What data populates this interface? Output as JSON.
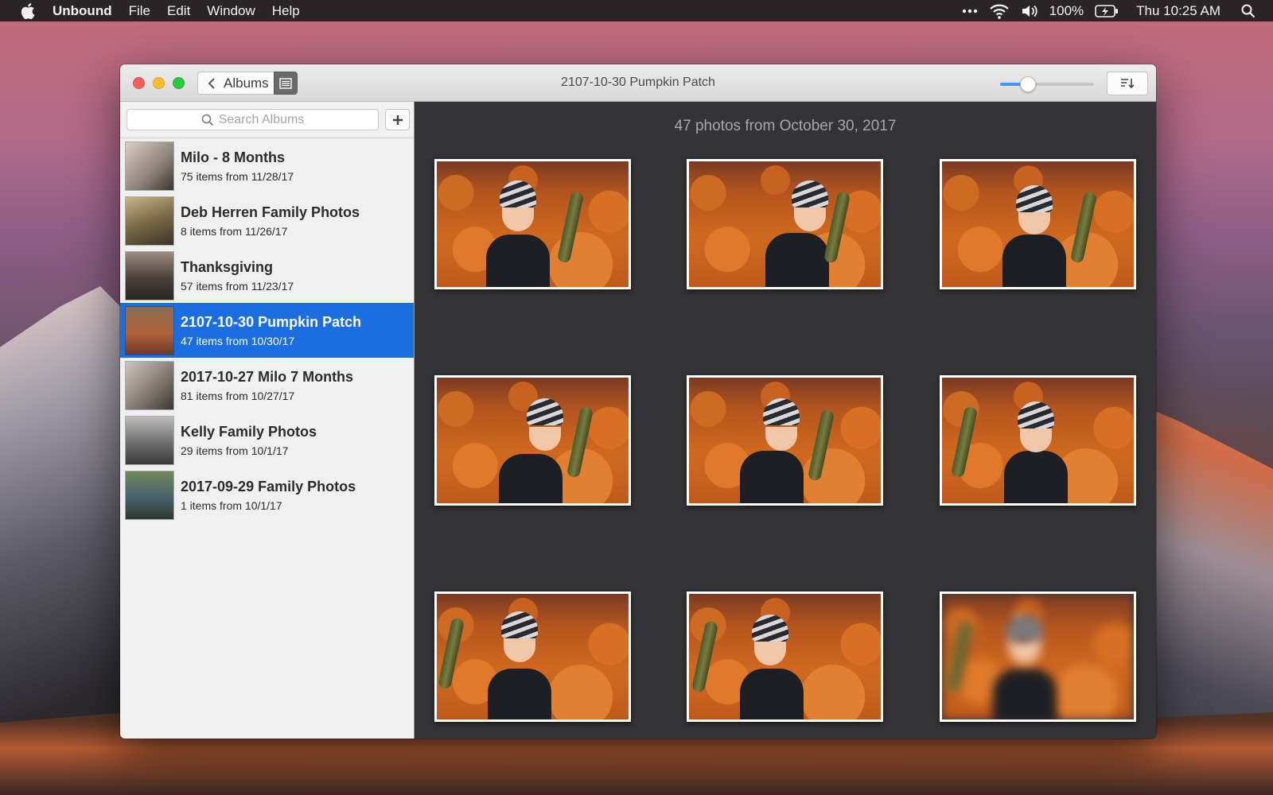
{
  "menubar": {
    "app_name": "Unbound",
    "items": [
      "File",
      "Edit",
      "Window",
      "Help"
    ],
    "battery": "100%",
    "clock": "Thu 10:25 AM"
  },
  "window": {
    "title": "2107-10-30 Pumpkin Patch",
    "back_label": "Albums",
    "zoom_level": 0.3
  },
  "sidebar": {
    "search_placeholder": "Search Albums",
    "albums": [
      {
        "name": "Milo - 8 Months",
        "meta": "75 items from 11/28/17"
      },
      {
        "name": "Deb Herren Family Photos",
        "meta": "8 items from 11/26/17"
      },
      {
        "name": "Thanksgiving",
        "meta": "57 items from 11/23/17"
      },
      {
        "name": "2107-10-30 Pumpkin Patch",
        "meta": "47 items from 10/30/17"
      },
      {
        "name": "2017-10-27 Milo 7 Months",
        "meta": "81 items from 10/27/17"
      },
      {
        "name": "Kelly Family Photos",
        "meta": "29 items from 10/1/17"
      },
      {
        "name": "2017-09-29 Family Photos",
        "meta": "1 items from 10/1/17"
      }
    ],
    "selected_index": 3
  },
  "content": {
    "header": "47 photos from October 30, 2017"
  },
  "colors": {
    "selection": "#1a6ee0",
    "slider_fill": "#3b99fc"
  }
}
